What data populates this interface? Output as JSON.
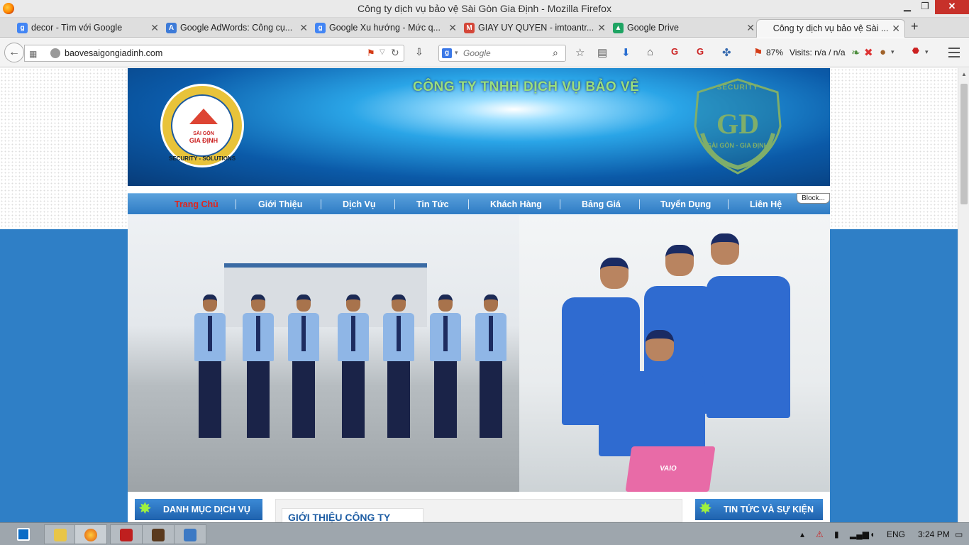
{
  "window": {
    "title": "Công ty dịch vụ bảo vệ Sài Gòn Gia Định - Mozilla Firefox",
    "min": "▁",
    "max": "❐",
    "close": "✕"
  },
  "tabs": [
    {
      "label": "decor - Tìm với Google",
      "icon": "google-icon",
      "color": "#4285f4"
    },
    {
      "label": "Google AdWords: Công cụ...",
      "icon": "adwords-icon",
      "color": "#3d7bd8"
    },
    {
      "label": "Google Xu hướng - Mức q...",
      "icon": "google-icon",
      "color": "#4285f4"
    },
    {
      "label": "GIAY UY QUYEN - imtoantr...",
      "icon": "gmail-icon",
      "color": "#d44638"
    },
    {
      "label": "Google Drive",
      "icon": "drive-icon",
      "color": "#1fa463"
    },
    {
      "label": "Công ty dịch vụ bảo vệ Sài ...",
      "icon": "",
      "color": ""
    }
  ],
  "toolbar": {
    "url": "baovesaigongiadinh.com",
    "search_placeholder": "Google",
    "zoom": "87%",
    "visits": "Visits: n/a / n/a"
  },
  "banner": {
    "tagline": "CÔNG TY TNHH DỊCH VỤ BẢO VỆ",
    "logo_name_small": "SÀI GÒN",
    "logo_name_big": "GIA ĐỊNH",
    "logo_ring": "SECURITY - SOLUTIONS",
    "shield_top": "SECURITY",
    "shield_bottom": "SÀI GÒN - GIA ĐỊNH"
  },
  "nav": {
    "items": [
      "Trang Chủ",
      "Giới Thiệu",
      "Dịch Vụ",
      "Tin Tức",
      "Khách Hàng",
      "Bảng Giá",
      "Tuyển Dụng",
      "Liên Hệ"
    ],
    "block_label": "Block..."
  },
  "hero": {
    "laptop_brand": "VAIO"
  },
  "sections": {
    "left_title": "DANH MỤC DỊCH VỤ",
    "center_title": "GIỚI THIỆU CÔNG TY",
    "right_title": "TIN TỨC VÀ SỰ KIỆN"
  },
  "taskbar": {
    "language": "ENG",
    "time": "3:24 PM"
  },
  "colors": {
    "accent": "#2e7bc4",
    "nav_active": "#e2231a",
    "star": "#9ef03f"
  }
}
